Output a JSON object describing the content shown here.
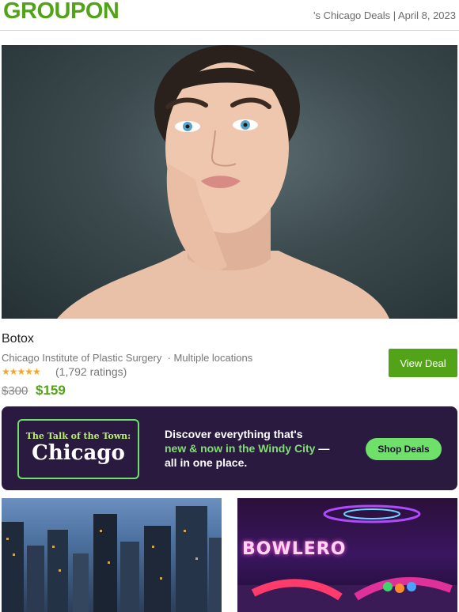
{
  "header": {
    "logo": "GROUPON",
    "meta": "'s Chicago Deals | April 8, 2023"
  },
  "deal": {
    "title": "Botox",
    "merchant": "Chicago Institute of Plastic Surgery",
    "locations": "Multiple locations",
    "stars": "★★★★★",
    "rating_value": 4.5,
    "ratings": "(1,792 ratings)",
    "price_old": "$300",
    "price_new": "$159",
    "cta": "View Deal"
  },
  "banner": {
    "kicker": "The Talk of the Town:",
    "city": "Chicago",
    "text_a": "Discover everything that's",
    "text_b": "new & now in the Windy City",
    "text_c": "— all in one place.",
    "cta": "Shop Deals",
    "colors": {
      "bg": "#2a1a3f",
      "accent": "#6fe06a"
    }
  },
  "tiles": {
    "right_sign": "BOWLERO"
  },
  "colors": {
    "brand": "#53a318"
  }
}
